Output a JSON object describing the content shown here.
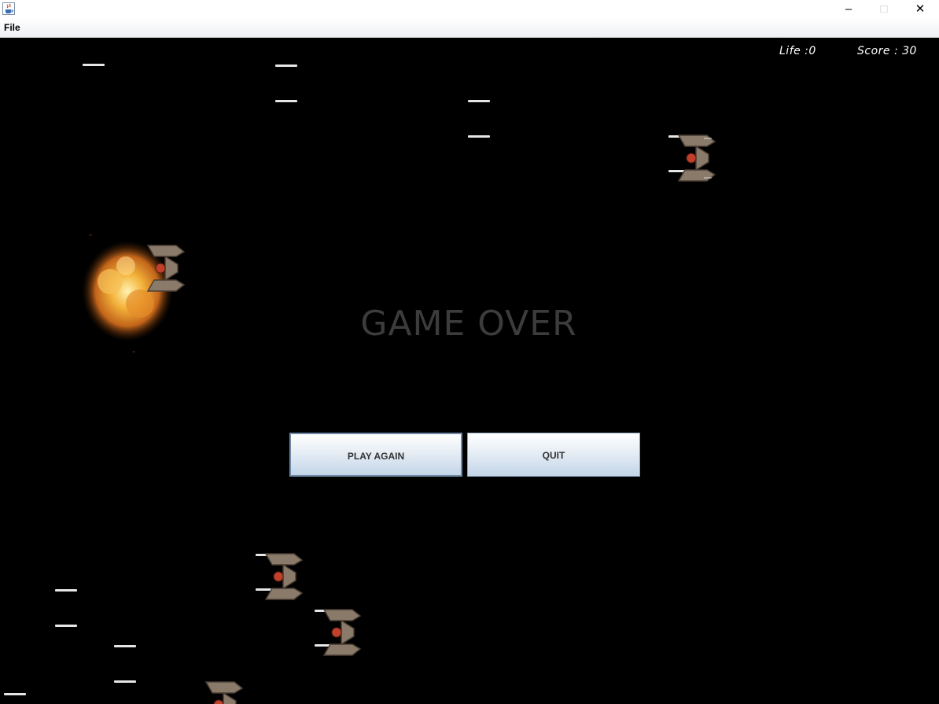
{
  "window": {
    "icon": "java-cup-icon",
    "controls": {
      "minimize": "–",
      "maximize": "□",
      "close": "✕"
    }
  },
  "menu": {
    "file_label": "File"
  },
  "hud": {
    "life_text": "Life :0",
    "score_text": "Score : 30"
  },
  "game": {
    "game_over_text": "GAME OVER",
    "enemy_sprite": "enemy-ship-icon",
    "explosion_sprite": "explosion-icon"
  },
  "buttons": {
    "play_again_label": "PLAY AGAIN",
    "quit_label": "QUIT"
  },
  "colors": {
    "background": "#000000",
    "bullet": "#e6e6e6",
    "game_over_text": "#3c3c3c"
  }
}
